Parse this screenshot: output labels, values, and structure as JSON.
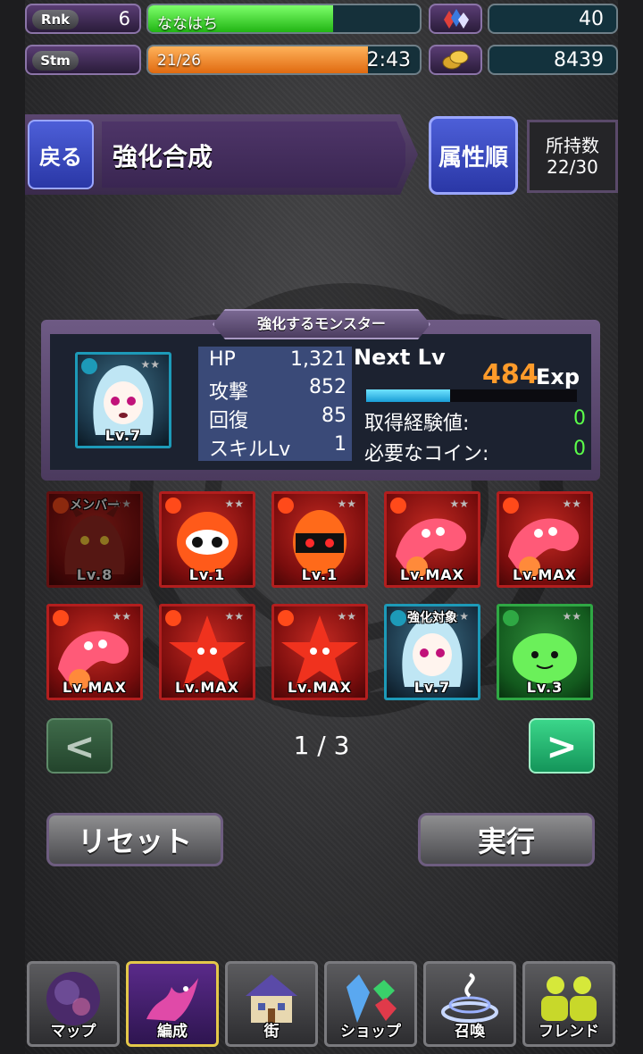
{
  "status": {
    "rank_tag": "Rnk",
    "rank_value": "6",
    "player_name": "ななはち",
    "exp_fill": 0.68,
    "stamina_tag": "Stm",
    "stamina_text": "21/26",
    "stamina_fill": 0.81,
    "stamina_timer": "2:43",
    "gems": "40",
    "coins": "8439"
  },
  "header": {
    "back_label": "戻る",
    "title": "強化合成",
    "sort_label": "属性順",
    "hold_label": "所持数",
    "hold_value": "22/30"
  },
  "target": {
    "panel_title": "強化するモンスター",
    "portrait_level": "Lv.7",
    "stats": [
      {
        "label": "HP",
        "value": "1,321"
      },
      {
        "label": "攻撃",
        "value": "852"
      },
      {
        "label": "回復",
        "value": "85"
      },
      {
        "label": "スキルLv",
        "value": "1"
      }
    ],
    "next_lv_label": "Next Lv",
    "exp_needed": "484",
    "exp_unit": "Exp",
    "exp_fill": 0.4,
    "gain_label": "取得経験値:",
    "gain_value": "0",
    "coin_label": "必要なコイン:",
    "coin_value": "0"
  },
  "monsters": [
    {
      "top": "メンバー",
      "level": "Lv.8",
      "attr": "fire",
      "kind": "dragon"
    },
    {
      "top": "",
      "level": "Lv.1",
      "attr": "fire",
      "kind": "bomb"
    },
    {
      "top": "",
      "level": "Lv.1",
      "attr": "fire",
      "kind": "bomb2"
    },
    {
      "top": "",
      "level": "Lv.MAX",
      "attr": "fire",
      "kind": "slug"
    },
    {
      "top": "",
      "level": "Lv.MAX",
      "attr": "fire",
      "kind": "slug"
    },
    {
      "top": "",
      "level": "Lv.MAX",
      "attr": "fire",
      "kind": "slug"
    },
    {
      "top": "",
      "level": "Lv.MAX",
      "attr": "fire",
      "kind": "star"
    },
    {
      "top": "",
      "level": "Lv.MAX",
      "attr": "fire",
      "kind": "star"
    },
    {
      "top": "強化対象",
      "level": "Lv.7",
      "attr": "water",
      "kind": "girl"
    },
    {
      "top": "",
      "level": "Lv.3",
      "attr": "wood",
      "kind": "slime"
    }
  ],
  "pager": {
    "prev": "<",
    "text": "1 / 3",
    "next": ">"
  },
  "actions": {
    "reset": "リセット",
    "execute": "実行"
  },
  "nav": [
    {
      "label": "マップ",
      "icon": "globe-icon"
    },
    {
      "label": "編成",
      "icon": "dragon-icon"
    },
    {
      "label": "街",
      "icon": "house-icon"
    },
    {
      "label": "ショップ",
      "icon": "crystal-icon"
    },
    {
      "label": "召喚",
      "icon": "summon-icon"
    },
    {
      "label": "フレンド",
      "icon": "friend-icon"
    }
  ],
  "colors": {
    "exp_bar": "#33d61e",
    "stamina_bar": "#f07a1a",
    "exp_number": "#ff9b2a",
    "zero_value": "#5bff4a",
    "fire_border": "#b31e1e",
    "water_border": "#1d9ab8",
    "wood_border": "#2fa844"
  }
}
